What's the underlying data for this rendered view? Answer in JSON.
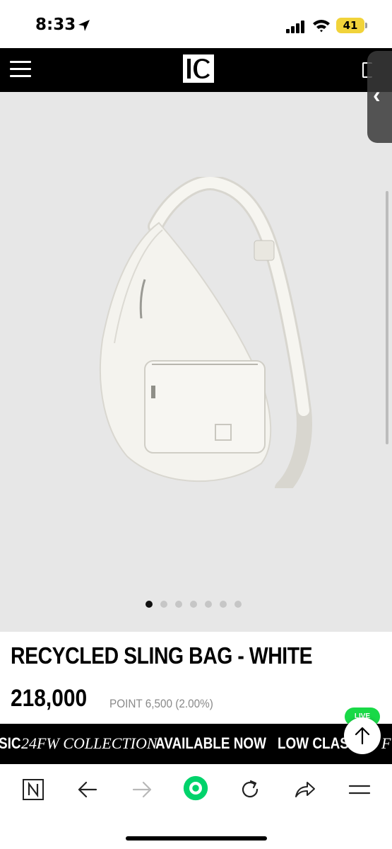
{
  "status_bar": {
    "time": "8:33",
    "battery_level": "41",
    "battery_color": "#f1d33a"
  },
  "header": {
    "logo_text": "IC",
    "background": "#000000"
  },
  "product": {
    "image_slide_count": 7,
    "active_slide_index": 0,
    "name": "RECYCLED SLING BAG - WHITE",
    "price": "218,000",
    "points": "POINT 6,500 (2.00%)"
  },
  "live_badge": "LIVE",
  "marquee": {
    "segment1_bold_a": "SIC",
    "segment1_serif": "24FW COLLECTION",
    "segment1_bold_b": "AVAILABLE NOW",
    "segment2_bold": "LOW CLASS",
    "segment2_serif_fragment": "F"
  },
  "toolbar": {
    "icons": [
      "naver-n-icon",
      "back-arrow-icon",
      "forward-arrow-icon",
      "green-home-icon",
      "refresh-icon",
      "share-icon",
      "menu-icon"
    ],
    "accent": "#00d36b"
  }
}
